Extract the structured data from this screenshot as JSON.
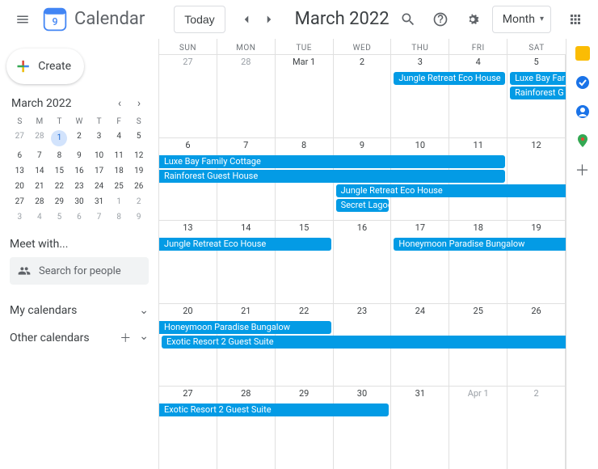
{
  "header": {
    "app_title": "Calendar",
    "today_label": "Today",
    "month_label": "March 2022",
    "view_label": "Month"
  },
  "sidebar": {
    "create_label": "Create",
    "mini_title": "March 2022",
    "day_heads": [
      "S",
      "M",
      "T",
      "W",
      "T",
      "F",
      "S"
    ],
    "mini_rows": [
      [
        {
          "n": "27",
          "o": true
        },
        {
          "n": "28",
          "o": true
        },
        {
          "n": "1",
          "today": true
        },
        {
          "n": "2"
        },
        {
          "n": "3"
        },
        {
          "n": "4"
        },
        {
          "n": "5"
        }
      ],
      [
        {
          "n": "6"
        },
        {
          "n": "7"
        },
        {
          "n": "8"
        },
        {
          "n": "9"
        },
        {
          "n": "10"
        },
        {
          "n": "11"
        },
        {
          "n": "12"
        }
      ],
      [
        {
          "n": "13"
        },
        {
          "n": "14"
        },
        {
          "n": "15"
        },
        {
          "n": "16"
        },
        {
          "n": "17"
        },
        {
          "n": "18"
        },
        {
          "n": "19"
        }
      ],
      [
        {
          "n": "20"
        },
        {
          "n": "21"
        },
        {
          "n": "22"
        },
        {
          "n": "23"
        },
        {
          "n": "24"
        },
        {
          "n": "25"
        },
        {
          "n": "26"
        }
      ],
      [
        {
          "n": "27"
        },
        {
          "n": "28"
        },
        {
          "n": "29"
        },
        {
          "n": "30"
        },
        {
          "n": "31"
        },
        {
          "n": "1",
          "o": true
        },
        {
          "n": "2",
          "o": true
        }
      ],
      [
        {
          "n": "3",
          "o": true
        },
        {
          "n": "4",
          "o": true
        },
        {
          "n": "5",
          "o": true
        },
        {
          "n": "6",
          "o": true
        },
        {
          "n": "7",
          "o": true
        },
        {
          "n": "8",
          "o": true
        },
        {
          "n": "9",
          "o": true
        }
      ]
    ],
    "meet_label": "Meet with...",
    "search_placeholder": "Search for people",
    "my_cal_label": "My calendars",
    "other_cal_label": "Other calendars"
  },
  "grid": {
    "weekday_heads": [
      "SUN",
      "MON",
      "TUE",
      "WED",
      "THU",
      "FRI",
      "SAT"
    ],
    "weeks": [
      {
        "days": [
          {
            "n": "27",
            "o": true
          },
          {
            "n": "28",
            "o": true
          },
          {
            "n": "Mar 1"
          },
          {
            "n": "2"
          },
          {
            "n": "3"
          },
          {
            "n": "4"
          },
          {
            "n": "5"
          }
        ],
        "events": [
          {
            "label": "Jungle Retreat Eco House",
            "start": 4,
            "span": 2,
            "row": 0
          },
          {
            "label": "Luxe Bay Far",
            "start": 6,
            "span": 1,
            "row": 0,
            "cont_right": true
          },
          {
            "label": "Rainforest G",
            "start": 6,
            "span": 1,
            "row": 1,
            "cont_right": true
          }
        ]
      },
      {
        "days": [
          {
            "n": "6"
          },
          {
            "n": "7"
          },
          {
            "n": "8"
          },
          {
            "n": "9"
          },
          {
            "n": "10"
          },
          {
            "n": "11"
          },
          {
            "n": "12"
          }
        ],
        "events": [
          {
            "label": "Luxe Bay Family Cottage",
            "start": 0,
            "span": 6,
            "row": 0,
            "cont_left": true
          },
          {
            "label": "Rainforest Guest House",
            "start": 0,
            "span": 6,
            "row": 1,
            "cont_left": true
          },
          {
            "label": "Jungle Retreat Eco House",
            "start": 3,
            "span": 4,
            "row": 2,
            "cont_right": true
          },
          {
            "label": "Secret Lagoo",
            "start": 3,
            "span": 1,
            "row": 3
          }
        ]
      },
      {
        "days": [
          {
            "n": "13"
          },
          {
            "n": "14"
          },
          {
            "n": "15"
          },
          {
            "n": "16"
          },
          {
            "n": "17"
          },
          {
            "n": "18"
          },
          {
            "n": "19"
          }
        ],
        "events": [
          {
            "label": "Jungle Retreat Eco House",
            "start": 0,
            "span": 3,
            "row": 0,
            "cont_left": true
          },
          {
            "label": "Honeymoon Paradise Bungalow",
            "start": 4,
            "span": 3,
            "row": 0,
            "cont_right": true
          }
        ]
      },
      {
        "days": [
          {
            "n": "20"
          },
          {
            "n": "21"
          },
          {
            "n": "22"
          },
          {
            "n": "23"
          },
          {
            "n": "24"
          },
          {
            "n": "25"
          },
          {
            "n": "26"
          }
        ],
        "events": [
          {
            "label": "Honeymoon Paradise Bungalow",
            "start": 0,
            "span": 3,
            "row": 0,
            "cont_left": true
          },
          {
            "label": "Exotic Resort 2 Guest Suite",
            "start": 0,
            "span": 7,
            "row": 1,
            "cont_right": true
          }
        ]
      },
      {
        "days": [
          {
            "n": "27"
          },
          {
            "n": "28"
          },
          {
            "n": "29"
          },
          {
            "n": "30"
          },
          {
            "n": "31"
          },
          {
            "n": "Apr 1",
            "o": true
          },
          {
            "n": "2",
            "o": true
          }
        ],
        "events": [
          {
            "label": "Exotic Resort 2 Guest Suite",
            "start": 0,
            "span": 4,
            "row": 0,
            "cont_left": true
          }
        ]
      }
    ]
  },
  "colors": {
    "event": "#039be5"
  }
}
